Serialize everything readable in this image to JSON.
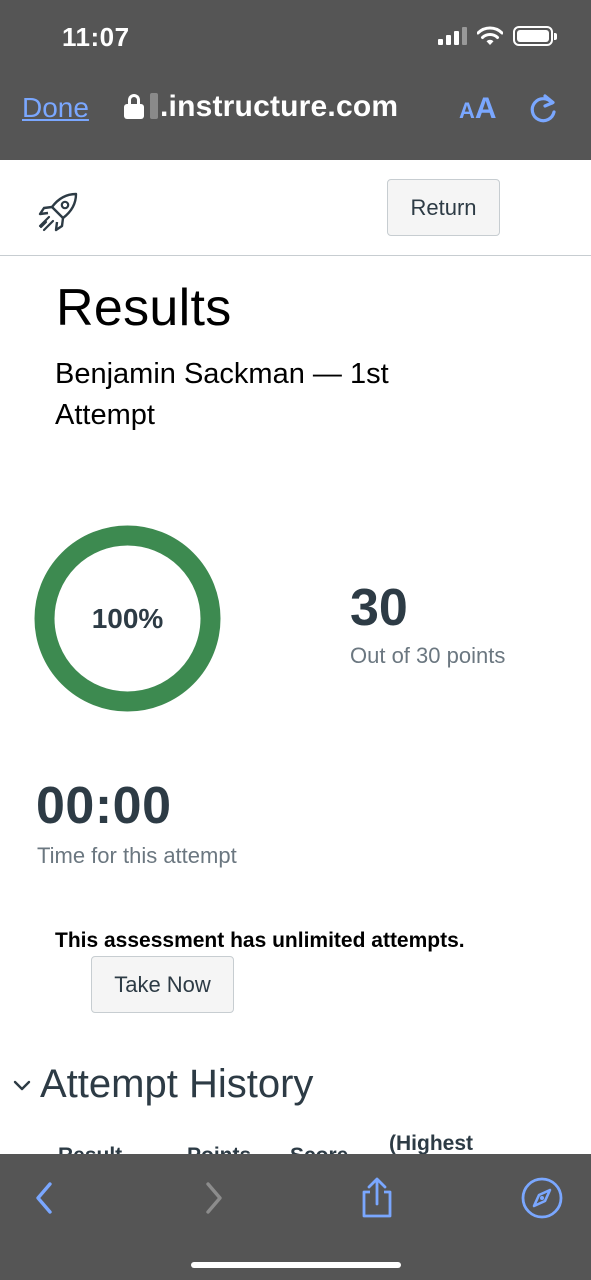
{
  "status_bar": {
    "time": "11:07"
  },
  "browser": {
    "done_label": "Done",
    "url": ".instructure.com",
    "text_size_small": "A",
    "text_size_large": "A",
    "accent": "#7aa7ff"
  },
  "header": {
    "return_label": "Return"
  },
  "results": {
    "title": "Results",
    "attempt_name": "Benjamin Sackman — 1st Attempt",
    "score_percent_label": "100%",
    "score_fraction": 1.0,
    "ring_color": "#3d8a50",
    "points": "30",
    "points_caption": "Out of 30 points",
    "time": "00:00",
    "time_caption": "Time for this attempt",
    "unlimited_notice": "This assessment has unlimited attempts.",
    "take_now_label": "Take Now"
  },
  "attempt_history": {
    "title": "Attempt History",
    "columns": [
      "Result",
      "Points",
      "Score",
      "(Highest"
    ]
  },
  "toolbar": {
    "icons": [
      "back-icon",
      "forward-icon",
      "share-icon",
      "safari-compass-icon"
    ]
  }
}
